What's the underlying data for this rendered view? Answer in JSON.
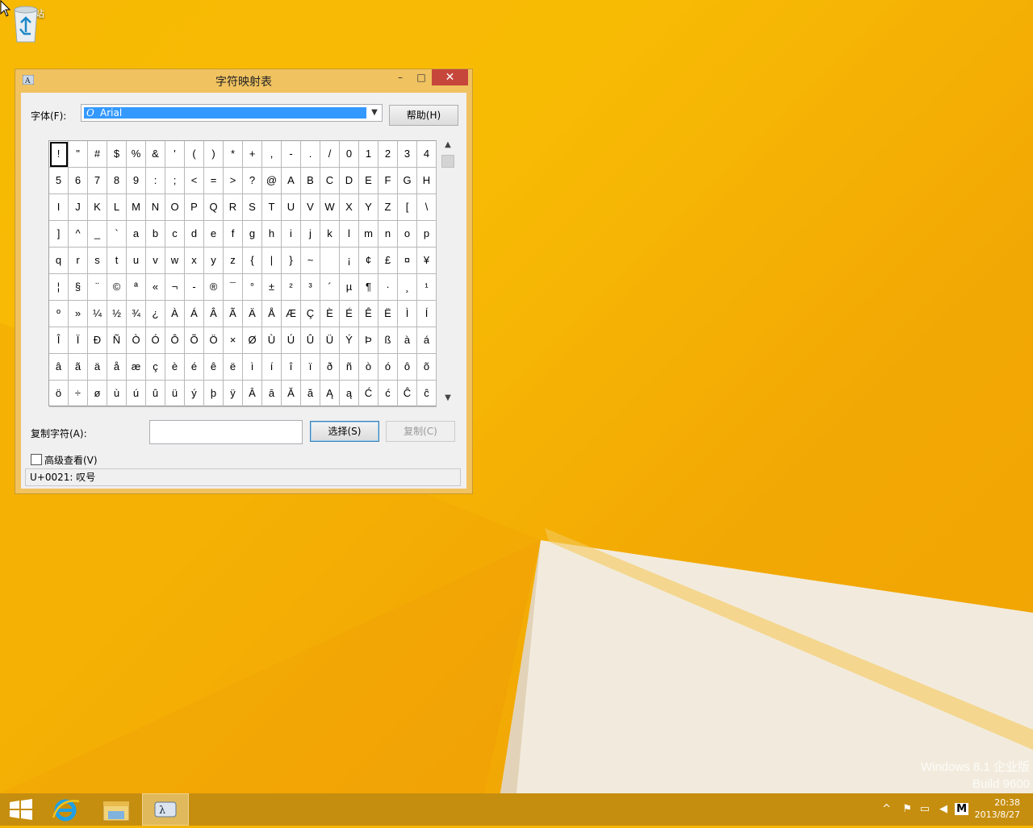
{
  "desktop": {
    "recycle_bin_label": "回收站",
    "watermark_line1": "Windows 8.1 企业版",
    "watermark_line2": "Build 9600"
  },
  "window": {
    "title": "字符映射表",
    "minimize": "–",
    "maximize": "□",
    "close": "✕",
    "font_label": "字体(F):",
    "font_value": "Arial",
    "help_button": "帮助(H)",
    "copy_label": "复制字符(A):",
    "copy_value": "",
    "select_button": "选择(S)",
    "copy_button": "复制(C)",
    "advanced_view": "高级查看(V)",
    "status": "U+0021: 叹号"
  },
  "characters": [
    [
      "!",
      "\"",
      "#",
      "$",
      "%",
      "&",
      "'",
      "(",
      ")",
      "*",
      "+",
      ",",
      "-",
      ".",
      "/",
      "0",
      "1",
      "2",
      "3",
      "4"
    ],
    [
      "5",
      "6",
      "7",
      "8",
      "9",
      ":",
      ";",
      "<",
      "=",
      ">",
      "?",
      "@",
      "A",
      "B",
      "C",
      "D",
      "E",
      "F",
      "G",
      "H"
    ],
    [
      "I",
      "J",
      "K",
      "L",
      "M",
      "N",
      "O",
      "P",
      "Q",
      "R",
      "S",
      "T",
      "U",
      "V",
      "W",
      "X",
      "Y",
      "Z",
      "[",
      "\\"
    ],
    [
      "]",
      "^",
      "_",
      "`",
      "a",
      "b",
      "c",
      "d",
      "e",
      "f",
      "g",
      "h",
      "i",
      "j",
      "k",
      "l",
      "m",
      "n",
      "o",
      "p"
    ],
    [
      "q",
      "r",
      "s",
      "t",
      "u",
      "v",
      "w",
      "x",
      "y",
      "z",
      "{",
      "|",
      "}",
      "~",
      " ",
      "¡",
      "¢",
      "£",
      "¤",
      "¥"
    ],
    [
      "¦",
      "§",
      "¨",
      "©",
      "ª",
      "«",
      "¬",
      "-",
      "®",
      "¯",
      "°",
      "±",
      "²",
      "³",
      "´",
      "µ",
      "¶",
      "·",
      "¸",
      "¹"
    ],
    [
      "º",
      "»",
      "¼",
      "½",
      "¾",
      "¿",
      "À",
      "Á",
      "Â",
      "Ã",
      "Ä",
      "Å",
      "Æ",
      "Ç",
      "È",
      "É",
      "Ê",
      "Ë",
      "Ì",
      "Í"
    ],
    [
      "Î",
      "Ï",
      "Ð",
      "Ñ",
      "Ò",
      "Ó",
      "Ô",
      "Õ",
      "Ö",
      "×",
      "Ø",
      "Ù",
      "Ú",
      "Û",
      "Ü",
      "Ý",
      "Þ",
      "ß",
      "à",
      "á"
    ],
    [
      "â",
      "ã",
      "ä",
      "å",
      "æ",
      "ç",
      "è",
      "é",
      "ê",
      "ë",
      "ì",
      "í",
      "î",
      "ï",
      "ð",
      "ñ",
      "ò",
      "ó",
      "ô",
      "õ"
    ],
    [
      "ö",
      "÷",
      "ø",
      "ù",
      "ú",
      "û",
      "ü",
      "ý",
      "þ",
      "ÿ",
      "Ā",
      "ā",
      "Ă",
      "ă",
      "Ą",
      "ą",
      "Ć",
      "ć",
      "Ĉ",
      "ĉ"
    ]
  ],
  "taskbar": {
    "time": "20:38",
    "date": "2013/8/27",
    "ime": "M",
    "items": [
      "start-icon",
      "internet-explorer-icon",
      "file-explorer-icon",
      "character-map-icon"
    ]
  },
  "colors": {
    "wallpaper": "#f7b903",
    "window_frame": "#f0c260",
    "close_button": "#c7463c",
    "selection": "#3399ff",
    "taskbar": "#c68e0f"
  }
}
